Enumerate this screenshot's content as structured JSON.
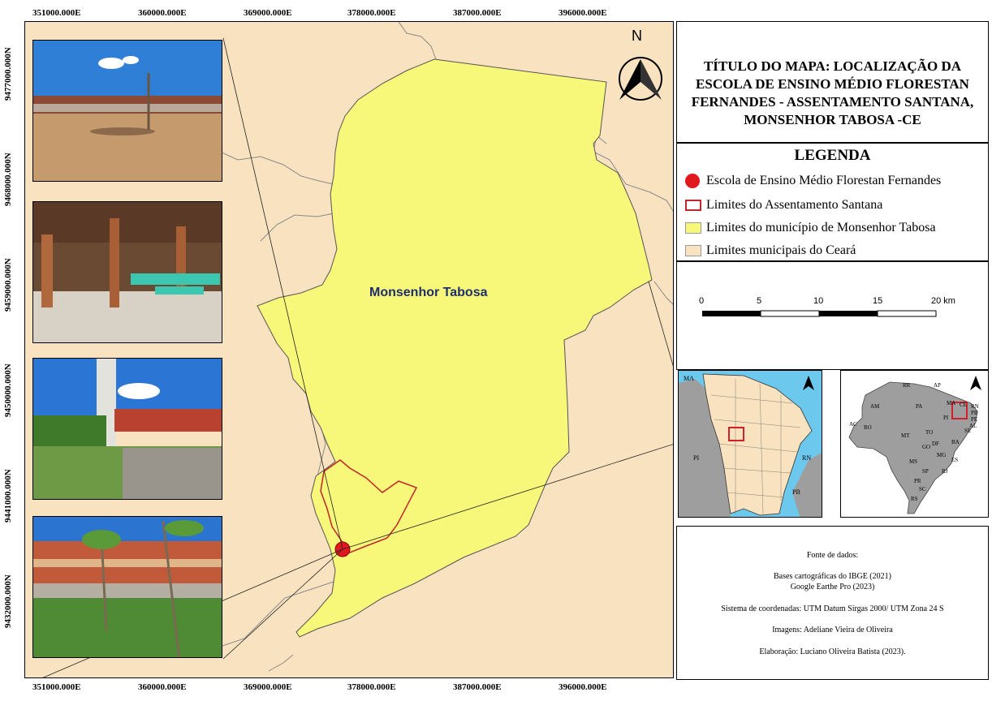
{
  "coords": {
    "top": [
      "351000.000E",
      "360000.000E",
      "369000.000E",
      "378000.000E",
      "387000.000E",
      "396000.000E"
    ],
    "bottom": [
      "351000.000E",
      "360000.000E",
      "369000.000E",
      "378000.000E",
      "387000.000E",
      "396000.000E"
    ],
    "left": [
      "9477000.000N",
      "9468000.000N",
      "9459000.000N",
      "9450000.000N",
      "9441000.000N",
      "9432000.000N"
    ]
  },
  "map": {
    "label": "Monsenhor Tabosa",
    "north_letter": "N",
    "colors": {
      "background": "#f9e2bf",
      "municipality": "#f7f77a",
      "settlement_outline": "#c0262b",
      "school_point": "#e0191f",
      "boundary": "#8a8a8a"
    }
  },
  "title": {
    "text": "TÍTULO DO MAPA: LOCALIZAÇÃO DA ESCOLA DE ENSINO MÉDIO FLORESTAN FERNANDES - ASSENTAMENTO SANTANA, MONSENHOR TABOSA -CE"
  },
  "legend": {
    "title": "LEGENDA",
    "items": [
      {
        "label": "Escola de Ensino Médio Florestan Fernandes",
        "symbol": "red-point"
      },
      {
        "label": "Limites do Assentamento Santana",
        "symbol": "red-outline"
      },
      {
        "label": "Limites do município de Monsenhor Tabosa",
        "symbol": "yellow-fill"
      },
      {
        "label": "Limites municipais do Ceará",
        "symbol": "beige-fill"
      }
    ]
  },
  "scale": {
    "labels": [
      "0",
      "5",
      "10",
      "15",
      "20 km"
    ]
  },
  "inset_ceara": {
    "labels": [
      "MA",
      "PI",
      "RN",
      "PB"
    ]
  },
  "inset_brazil": {
    "labels": [
      "RR",
      "AP",
      "AM",
      "PA",
      "MA",
      "CE",
      "RN",
      "PB",
      "PE",
      "AL",
      "SE",
      "AC",
      "RO",
      "TO",
      "PI",
      "MT",
      "BA",
      "GO",
      "DF",
      "MG",
      "ES",
      "MS",
      "SP",
      "RJ",
      "PR",
      "SC",
      "RS"
    ]
  },
  "sources": {
    "heading": "Fonte de dados:",
    "lines": [
      "Bases cartográficas do IBGE (2021)",
      "Google Earthe Pro (2023)",
      "Sistema de coordenadas: UTM Datum Sirgas 2000/ UTM Zona 24 S",
      "Imagens: Adeliane Vieira de Oliveira",
      "Elaboração: Luciano Oliveira Batista (2023)."
    ]
  }
}
